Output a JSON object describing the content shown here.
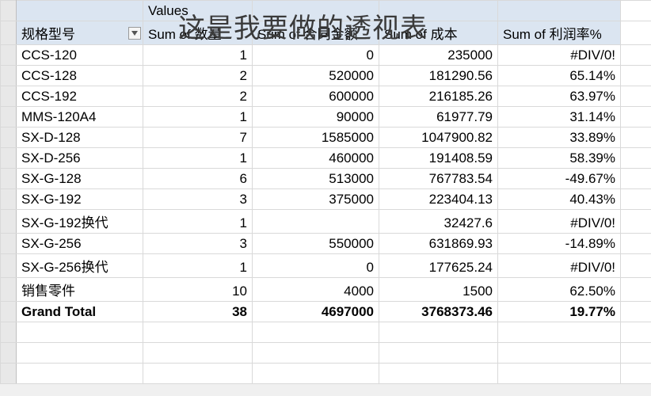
{
  "overlay_title": "这是我要做的透视表",
  "values_label": "Values",
  "row_field_label": "规格型号",
  "columns": {
    "c1": "Sum of 数量",
    "c2": "Sum of 合同金额",
    "c3": "Sum of 成本",
    "c4": "Sum of 利润率%"
  },
  "rows": [
    {
      "label": "CCS-120",
      "qty": "1",
      "contract": "0",
      "cost": "235000",
      "margin": "#DIV/0!"
    },
    {
      "label": "CCS-128",
      "qty": "2",
      "contract": "520000",
      "cost": "181290.56",
      "margin": "65.14%"
    },
    {
      "label": "CCS-192",
      "qty": "2",
      "contract": "600000",
      "cost": "216185.26",
      "margin": "63.97%"
    },
    {
      "label": "MMS-120A4",
      "qty": "1",
      "contract": "90000",
      "cost": "61977.79",
      "margin": "31.14%"
    },
    {
      "label": "SX-D-128",
      "qty": "7",
      "contract": "1585000",
      "cost": "1047900.82",
      "margin": "33.89%"
    },
    {
      "label": "SX-D-256",
      "qty": "1",
      "contract": "460000",
      "cost": "191408.59",
      "margin": "58.39%"
    },
    {
      "label": "SX-G-128",
      "qty": "6",
      "contract": "513000",
      "cost": "767783.54",
      "margin": "-49.67%"
    },
    {
      "label": "SX-G-192",
      "qty": "3",
      "contract": "375000",
      "cost": "223404.13",
      "margin": "40.43%"
    },
    {
      "label": "SX-G-192换代",
      "qty": "1",
      "contract": "",
      "cost": "32427.6",
      "margin": "#DIV/0!"
    },
    {
      "label": "SX-G-256",
      "qty": "3",
      "contract": "550000",
      "cost": "631869.93",
      "margin": "-14.89%"
    },
    {
      "label": "SX-G-256换代",
      "qty": "1",
      "contract": "0",
      "cost": "177625.24",
      "margin": "#DIV/0!"
    },
    {
      "label": "销售零件",
      "qty": "10",
      "contract": "4000",
      "cost": "1500",
      "margin": "62.50%"
    }
  ],
  "grand_total": {
    "label": "Grand Total",
    "qty": "38",
    "contract": "4697000",
    "cost": "3768373.46",
    "margin": "19.77%"
  }
}
